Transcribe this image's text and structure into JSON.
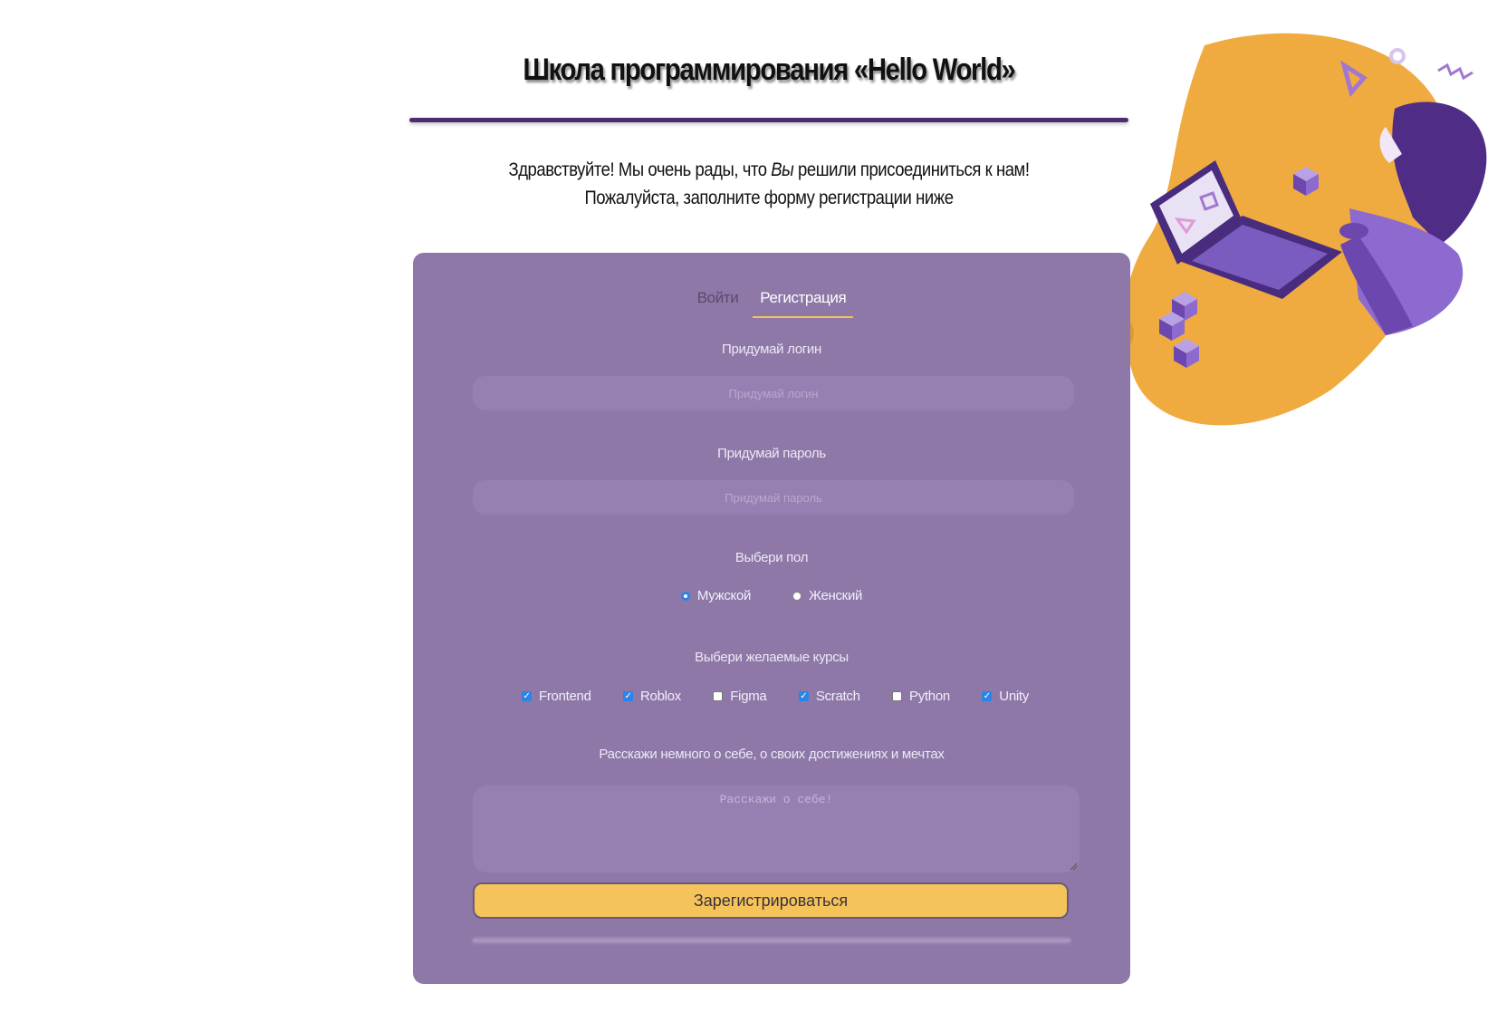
{
  "header": {
    "title": "Школа программирования «Hello World»",
    "greeting_before": "Здравствуйте! Мы очень рады, что ",
    "greeting_emphasis": "Вы",
    "greeting_after": " решили присоединиться к нам!",
    "greeting_line2": "Пожалуйста, заполните форму регистрации ниже"
  },
  "tabs": [
    {
      "label": "Войти",
      "active": false
    },
    {
      "label": "Регистрация",
      "active": true
    }
  ],
  "form": {
    "login": {
      "label": "Придумай логин",
      "placeholder": "Придумай логин",
      "value": ""
    },
    "password": {
      "label": "Придумай пароль",
      "placeholder": "Придумай пароль",
      "value": ""
    },
    "gender": {
      "label": "Выбери пол",
      "options": [
        {
          "label": "Мужской",
          "checked": true
        },
        {
          "label": "Женский",
          "checked": false
        }
      ]
    },
    "courses": {
      "label": "Выбери желаемые курсы",
      "options": [
        {
          "label": "Frontend",
          "checked": true
        },
        {
          "label": "Roblox",
          "checked": true
        },
        {
          "label": "Figma",
          "checked": false
        },
        {
          "label": "Scratch",
          "checked": true
        },
        {
          "label": "Python",
          "checked": false
        },
        {
          "label": "Unity",
          "checked": true
        }
      ]
    },
    "about": {
      "label": "Расскажи немного о себе, о своих достижениях и мечтах",
      "placeholder": "Расскажи о себе!",
      "value": ""
    },
    "submit_label": "Зарегистрироваться"
  },
  "colors": {
    "card_bg": "#8d78a8",
    "accent": "#f4c35a",
    "title_rule": "#4a2e6e",
    "input_bg": "#9680b2"
  }
}
